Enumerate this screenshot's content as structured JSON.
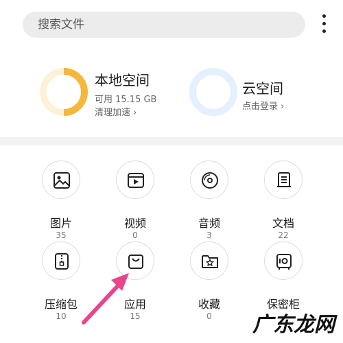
{
  "search": {
    "placeholder": "搜索文件"
  },
  "menu": {
    "icon": "more-vertical-icon"
  },
  "storage": {
    "local": {
      "title": "本地空间",
      "available": "可用 15.15 GB",
      "action": "清理加速 ›",
      "ring_fill_fraction": 0.5,
      "ring_color": "#f6b73c"
    },
    "cloud": {
      "title": "云空间",
      "action": "点击登录 ›",
      "ring_color": "#e4efff"
    }
  },
  "categories": [
    {
      "label": "图片",
      "count": "35",
      "icon": "image-icon"
    },
    {
      "label": "视频",
      "count": "0",
      "icon": "video-icon"
    },
    {
      "label": "音频",
      "count": "3",
      "icon": "music-disc-icon"
    },
    {
      "label": "文档",
      "count": "22",
      "icon": "document-icon"
    },
    {
      "label": "压缩包",
      "count": "10",
      "icon": "zip-icon"
    },
    {
      "label": "应用",
      "count": "15",
      "icon": "shopping-bag-icon"
    },
    {
      "label": "收藏",
      "count": "0",
      "icon": "star-folder-icon"
    },
    {
      "label": "保密柜",
      "count": "",
      "icon": "safe-icon"
    }
  ],
  "annotation": {
    "arrow_color": "#e8458b"
  },
  "watermark": {
    "text": "广东龙网"
  }
}
